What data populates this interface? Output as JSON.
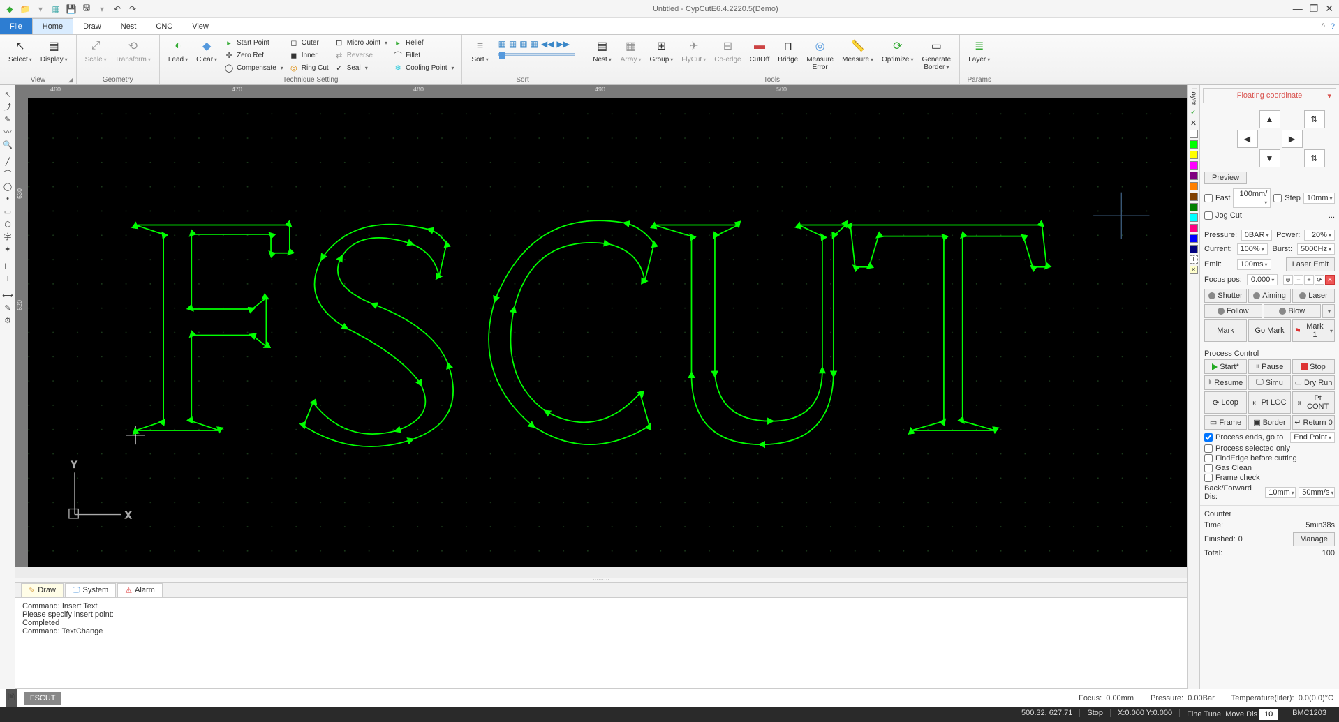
{
  "title": "Untitled - CypCutE6.4.2220.5(Demo)",
  "tabs": {
    "file": "File",
    "home": "Home",
    "draw": "Draw",
    "nest": "Nest",
    "cnc": "CNC",
    "view": "View"
  },
  "ribbon": {
    "view": {
      "select": "Select",
      "display": "Display",
      "label": "View"
    },
    "geometry": {
      "scale": "Scale",
      "transform": "Transform",
      "label": "Geometry"
    },
    "tech": {
      "lead": "Lead",
      "clear": "Clear",
      "startpoint": "Start Point",
      "zeroref": "Zero Ref",
      "compensate": "Compensate",
      "outer": "Outer",
      "inner": "Inner",
      "ringcut": "Ring Cut",
      "microjoint": "Micro Joint",
      "reverse": "Reverse",
      "seal": "Seal",
      "relief": "Relief",
      "fillet": "Fillet",
      "coolingpoint": "Cooling Point",
      "label": "Technique Setting"
    },
    "sort": {
      "sort": "Sort",
      "label": "Sort"
    },
    "tools": {
      "nest": "Nest",
      "array": "Array",
      "group": "Group",
      "flycut": "FlyCut",
      "coedge": "Co-edge",
      "cutoff": "CutOff",
      "bridge": "Bridge",
      "measureerror": "Measure\nError",
      "measure": "Measure",
      "optimize": "Optimize",
      "generateborder": "Generate\nBorder",
      "label": "Tools"
    },
    "params": {
      "layer": "Layer",
      "label": "Params"
    }
  },
  "ruler": {
    "h": [
      "460",
      "470",
      "480",
      "490",
      "500"
    ],
    "v": [
      "630",
      "620"
    ]
  },
  "rightpanel": {
    "floatcoord": "Floating coordinate",
    "preview": "Preview",
    "fast": "Fast",
    "fast_val": "100mm/",
    "step": "Step",
    "step_val": "10mm",
    "jogcut": "Jog Cut",
    "jogcut_more": "...",
    "pressure": "Pressure:",
    "pressure_val": "0BAR",
    "power": "Power:",
    "power_val": "20%",
    "current": "Current:",
    "current_val": "100%",
    "burst": "Burst:",
    "burst_val": "5000Hz",
    "emit": "Emit:",
    "emit_val": "100ms",
    "laseremit": "Laser Emit",
    "focuspos": "Focus pos:",
    "focuspos_val": "0.000",
    "shutter": "Shutter",
    "aiming": "Aiming",
    "laser": "Laser",
    "follow": "Follow",
    "blow": "Blow",
    "mark": "Mark",
    "gomark": "Go Mark",
    "mark1": "Mark 1",
    "proc_title": "Process Control",
    "start": "Start*",
    "pause": "Pause",
    "stop": "Stop",
    "resume": "Resume",
    "simu": "Simu",
    "dryrun": "Dry Run",
    "loop": "Loop",
    "ptloc": "Pt LOC",
    "ptcont": "Pt CONT",
    "frame": "Frame",
    "border": "Border",
    "return0": "Return 0",
    "procends": "Process ends, go to",
    "endpoint": "End Point",
    "procsel": "Process selected only",
    "findedge": "FindEdge before cutting",
    "gasclean": "Gas Clean",
    "framecheck": "Frame check",
    "backforward": "Back/Forward Dis:",
    "bf_val1": "10mm",
    "bf_val2": "50mm/s",
    "counter": "Counter",
    "time": "Time:",
    "time_val": "5min38s",
    "finished": "Finished:",
    "finished_val": "0",
    "total": "Total:",
    "total_val": "100",
    "manage": "Manage"
  },
  "logtabs": {
    "draw": "Draw",
    "system": "System",
    "alarm": "Alarm"
  },
  "log": {
    "l1": "Command: Insert Text",
    "l2": "Please specify insert point:",
    "l3": "Completed",
    "l4": "Command: TextChange"
  },
  "status1": {
    "fscut": "FSCUT",
    "focus": "Focus:",
    "focus_val": "0.00mm",
    "pressure": "Pressure:",
    "pressure_val": "0.00Bar",
    "temp": "Temperature(liter):",
    "temp_val": "0.0(0.0)°C"
  },
  "status2": {
    "coord": "500.32, 627.71",
    "stop": "Stop",
    "xy": "X:0.000 Y:0.000",
    "finetune": "Fine Tune",
    "movedis": "Move Dis",
    "movedis_val": "10",
    "bmc": "BMC1203"
  },
  "layer_colors": [
    "#00ff00",
    "#ffff00",
    "#ff8000",
    "#ff00ff",
    "#800080",
    "#00ffff",
    "#008000",
    "#0000ff",
    "#000080"
  ]
}
